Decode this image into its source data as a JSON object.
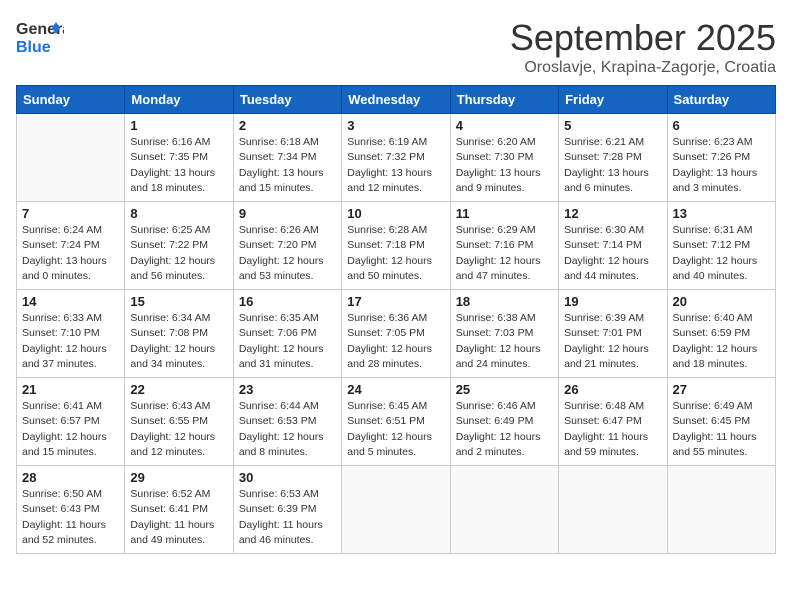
{
  "header": {
    "logo_general": "General",
    "logo_blue": "Blue",
    "month_title": "September 2025",
    "subtitle": "Oroslavje, Krapina-Zagorje, Croatia"
  },
  "weekdays": [
    "Sunday",
    "Monday",
    "Tuesday",
    "Wednesday",
    "Thursday",
    "Friday",
    "Saturday"
  ],
  "weeks": [
    [
      {
        "day": "",
        "info": ""
      },
      {
        "day": "1",
        "info": "Sunrise: 6:16 AM\nSunset: 7:35 PM\nDaylight: 13 hours\nand 18 minutes."
      },
      {
        "day": "2",
        "info": "Sunrise: 6:18 AM\nSunset: 7:34 PM\nDaylight: 13 hours\nand 15 minutes."
      },
      {
        "day": "3",
        "info": "Sunrise: 6:19 AM\nSunset: 7:32 PM\nDaylight: 13 hours\nand 12 minutes."
      },
      {
        "day": "4",
        "info": "Sunrise: 6:20 AM\nSunset: 7:30 PM\nDaylight: 13 hours\nand 9 minutes."
      },
      {
        "day": "5",
        "info": "Sunrise: 6:21 AM\nSunset: 7:28 PM\nDaylight: 13 hours\nand 6 minutes."
      },
      {
        "day": "6",
        "info": "Sunrise: 6:23 AM\nSunset: 7:26 PM\nDaylight: 13 hours\nand 3 minutes."
      }
    ],
    [
      {
        "day": "7",
        "info": "Sunrise: 6:24 AM\nSunset: 7:24 PM\nDaylight: 13 hours\nand 0 minutes."
      },
      {
        "day": "8",
        "info": "Sunrise: 6:25 AM\nSunset: 7:22 PM\nDaylight: 12 hours\nand 56 minutes."
      },
      {
        "day": "9",
        "info": "Sunrise: 6:26 AM\nSunset: 7:20 PM\nDaylight: 12 hours\nand 53 minutes."
      },
      {
        "day": "10",
        "info": "Sunrise: 6:28 AM\nSunset: 7:18 PM\nDaylight: 12 hours\nand 50 minutes."
      },
      {
        "day": "11",
        "info": "Sunrise: 6:29 AM\nSunset: 7:16 PM\nDaylight: 12 hours\nand 47 minutes."
      },
      {
        "day": "12",
        "info": "Sunrise: 6:30 AM\nSunset: 7:14 PM\nDaylight: 12 hours\nand 44 minutes."
      },
      {
        "day": "13",
        "info": "Sunrise: 6:31 AM\nSunset: 7:12 PM\nDaylight: 12 hours\nand 40 minutes."
      }
    ],
    [
      {
        "day": "14",
        "info": "Sunrise: 6:33 AM\nSunset: 7:10 PM\nDaylight: 12 hours\nand 37 minutes."
      },
      {
        "day": "15",
        "info": "Sunrise: 6:34 AM\nSunset: 7:08 PM\nDaylight: 12 hours\nand 34 minutes."
      },
      {
        "day": "16",
        "info": "Sunrise: 6:35 AM\nSunset: 7:06 PM\nDaylight: 12 hours\nand 31 minutes."
      },
      {
        "day": "17",
        "info": "Sunrise: 6:36 AM\nSunset: 7:05 PM\nDaylight: 12 hours\nand 28 minutes."
      },
      {
        "day": "18",
        "info": "Sunrise: 6:38 AM\nSunset: 7:03 PM\nDaylight: 12 hours\nand 24 minutes."
      },
      {
        "day": "19",
        "info": "Sunrise: 6:39 AM\nSunset: 7:01 PM\nDaylight: 12 hours\nand 21 minutes."
      },
      {
        "day": "20",
        "info": "Sunrise: 6:40 AM\nSunset: 6:59 PM\nDaylight: 12 hours\nand 18 minutes."
      }
    ],
    [
      {
        "day": "21",
        "info": "Sunrise: 6:41 AM\nSunset: 6:57 PM\nDaylight: 12 hours\nand 15 minutes."
      },
      {
        "day": "22",
        "info": "Sunrise: 6:43 AM\nSunset: 6:55 PM\nDaylight: 12 hours\nand 12 minutes."
      },
      {
        "day": "23",
        "info": "Sunrise: 6:44 AM\nSunset: 6:53 PM\nDaylight: 12 hours\nand 8 minutes."
      },
      {
        "day": "24",
        "info": "Sunrise: 6:45 AM\nSunset: 6:51 PM\nDaylight: 12 hours\nand 5 minutes."
      },
      {
        "day": "25",
        "info": "Sunrise: 6:46 AM\nSunset: 6:49 PM\nDaylight: 12 hours\nand 2 minutes."
      },
      {
        "day": "26",
        "info": "Sunrise: 6:48 AM\nSunset: 6:47 PM\nDaylight: 11 hours\nand 59 minutes."
      },
      {
        "day": "27",
        "info": "Sunrise: 6:49 AM\nSunset: 6:45 PM\nDaylight: 11 hours\nand 55 minutes."
      }
    ],
    [
      {
        "day": "28",
        "info": "Sunrise: 6:50 AM\nSunset: 6:43 PM\nDaylight: 11 hours\nand 52 minutes."
      },
      {
        "day": "29",
        "info": "Sunrise: 6:52 AM\nSunset: 6:41 PM\nDaylight: 11 hours\nand 49 minutes."
      },
      {
        "day": "30",
        "info": "Sunrise: 6:53 AM\nSunset: 6:39 PM\nDaylight: 11 hours\nand 46 minutes."
      },
      {
        "day": "",
        "info": ""
      },
      {
        "day": "",
        "info": ""
      },
      {
        "day": "",
        "info": ""
      },
      {
        "day": "",
        "info": ""
      }
    ]
  ]
}
